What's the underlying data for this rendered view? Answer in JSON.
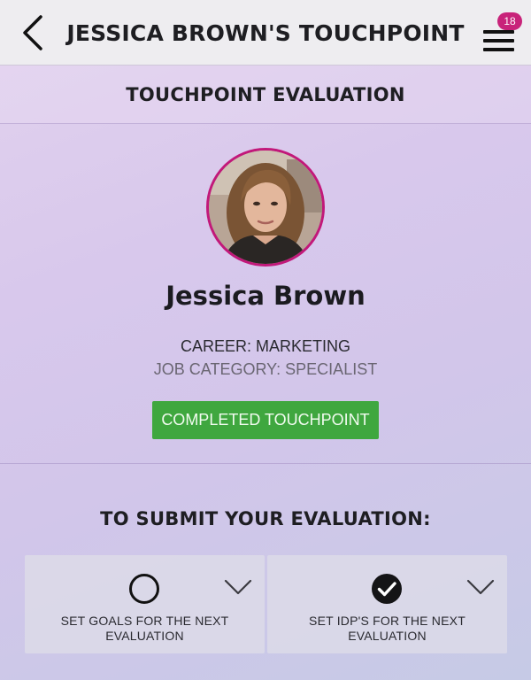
{
  "header": {
    "title": "JESSICA BROWN'S TOUCHPOINT",
    "back_icon": "chevron-left-icon",
    "menu_icon": "hamburger-menu-icon",
    "notification_count": "18"
  },
  "section": {
    "title": "TOUCHPOINT EVALUATION"
  },
  "profile": {
    "name": "Jessica Brown",
    "career": "CAREER: MARKETING",
    "job_category": "JOB CATEGORY: SPECIALIST",
    "status_button": "COMPLETED TOUCHPOINT"
  },
  "submit": {
    "title": "TO SUBMIT YOUR EVALUATION:",
    "tasks": [
      {
        "label": "SET GOALS FOR THE NEXT EVALUATION",
        "completed": false,
        "icon": "empty-circle-icon"
      },
      {
        "label": "SET IDP'S FOR THE NEXT EVALUATION",
        "completed": true,
        "icon": "check-circle-icon"
      }
    ]
  },
  "colors": {
    "accent": "#c2187a",
    "badge": "#c8237a",
    "status_green": "#3fa73f",
    "header_bg": "#eeedf0"
  }
}
